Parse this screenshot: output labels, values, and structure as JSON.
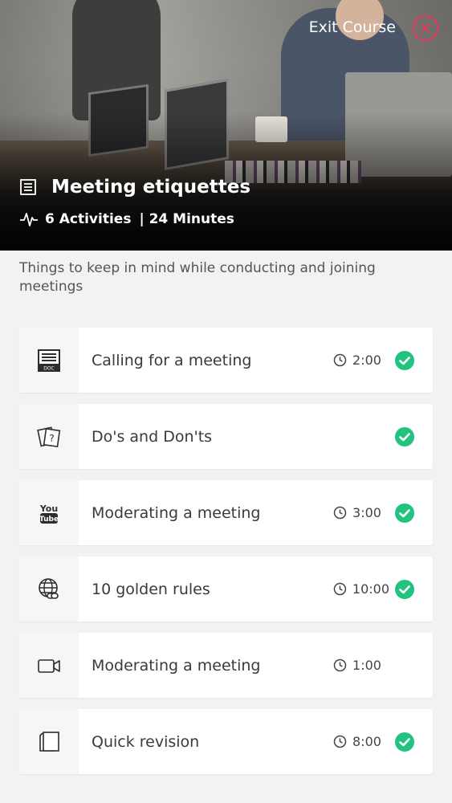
{
  "header": {
    "exit_label": "Exit Course",
    "course_title": "Meeting etiquettes",
    "activities": "6 Activities",
    "minutes": "| 24 Minutes",
    "icons": {
      "course": "document-lines-icon",
      "activities": "pulse-icon",
      "close": "close-circle-icon"
    }
  },
  "description": "Things to keep in mind while conducting and joining meetings",
  "accent_colors": {
    "complete": "#22c37f",
    "close": "#e8365d"
  },
  "activities": [
    {
      "icon": "doc-file-icon",
      "title": "Calling for a meeting",
      "duration": "2:00",
      "completed": true
    },
    {
      "icon": "question-cards-icon",
      "title": "Do's and Don'ts",
      "duration": "",
      "completed": true
    },
    {
      "icon": "youtube-icon",
      "title": "Moderating a meeting",
      "duration": "3:00",
      "completed": true
    },
    {
      "icon": "globe-link-icon",
      "title": "10 golden rules",
      "duration": "10:00",
      "completed": true
    },
    {
      "icon": "video-camera-icon",
      "title": "Moderating a meeting",
      "duration": "1:00",
      "completed": false
    },
    {
      "icon": "flashcards-icon",
      "title": "Quick revision",
      "duration": "8:00",
      "completed": true
    }
  ]
}
